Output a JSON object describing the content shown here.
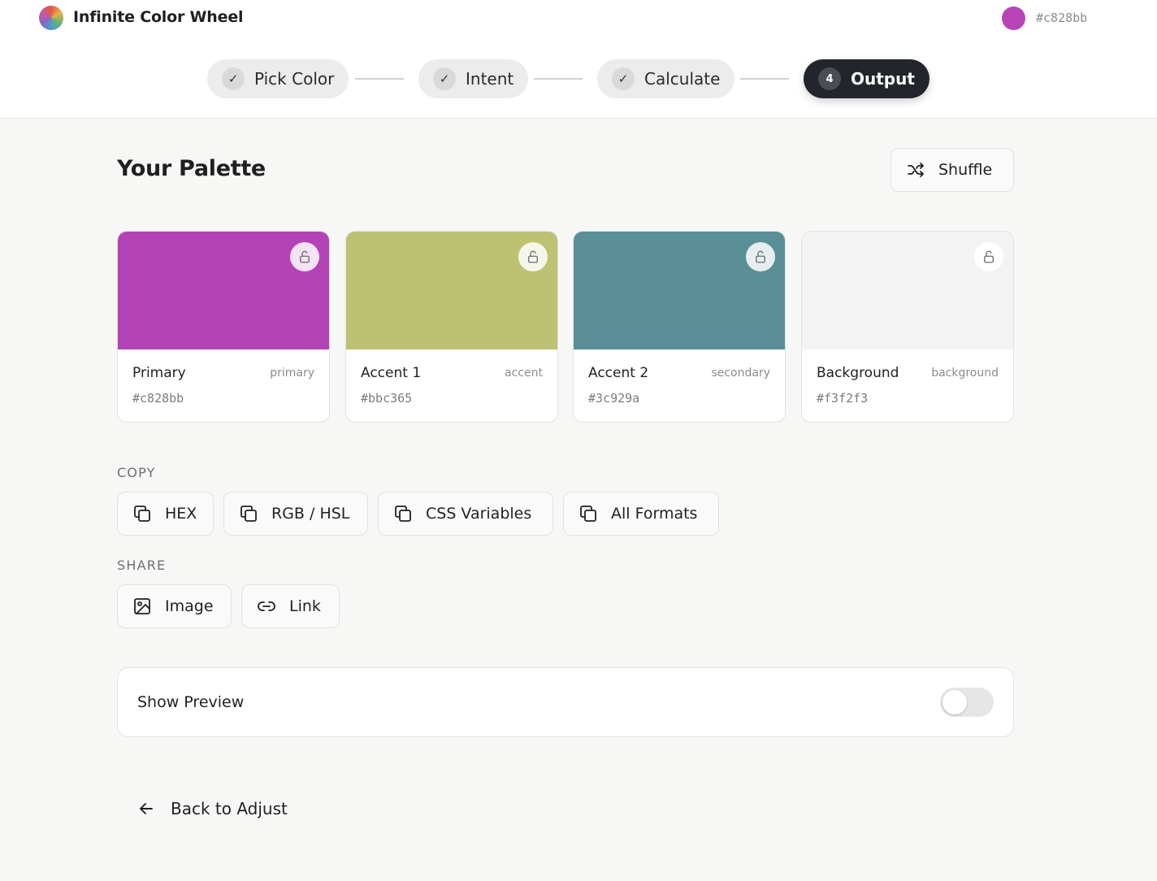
{
  "header": {
    "app_title": "Infinite Color Wheel",
    "current_color": {
      "hex": "#c828bb",
      "swatch_color": "#b843b8"
    }
  },
  "steps": [
    {
      "label": "Pick Color",
      "badge": "✓",
      "state": "done"
    },
    {
      "label": "Intent",
      "badge": "✓",
      "state": "done"
    },
    {
      "label": "Calculate",
      "badge": "✓",
      "state": "done"
    },
    {
      "label": "Output",
      "badge": "4",
      "state": "active"
    }
  ],
  "main": {
    "title": "Your Palette",
    "shuffle_label": "Shuffle",
    "palette": [
      {
        "name": "Primary",
        "role": "primary",
        "hex": "#c828bb",
        "display_color": "#b443b6"
      },
      {
        "name": "Accent 1",
        "role": "accent",
        "hex": "#bbc365",
        "display_color": "#bdc172"
      },
      {
        "name": "Accent 2",
        "role": "secondary",
        "hex": "#3c929a",
        "display_color": "#5a8f98"
      },
      {
        "name": "Background",
        "role": "background",
        "hex": "#f3f2f3",
        "display_color": "#f3f3f3"
      }
    ],
    "copy": {
      "label": "COPY",
      "buttons": [
        "HEX",
        "RGB / HSL",
        "CSS Variables",
        "All Formats"
      ]
    },
    "share": {
      "label": "SHARE",
      "buttons": [
        "Image",
        "Link"
      ]
    },
    "preview": {
      "label": "Show Preview",
      "enabled": false
    },
    "back_label": "Back to Adjust"
  },
  "icons": {
    "step_done": "check-icon",
    "shuffle": "shuffle-icon",
    "lock": "unlock-icon",
    "copy": "copy-icon",
    "image": "image-icon",
    "link": "link-icon",
    "back": "arrow-left-icon"
  }
}
